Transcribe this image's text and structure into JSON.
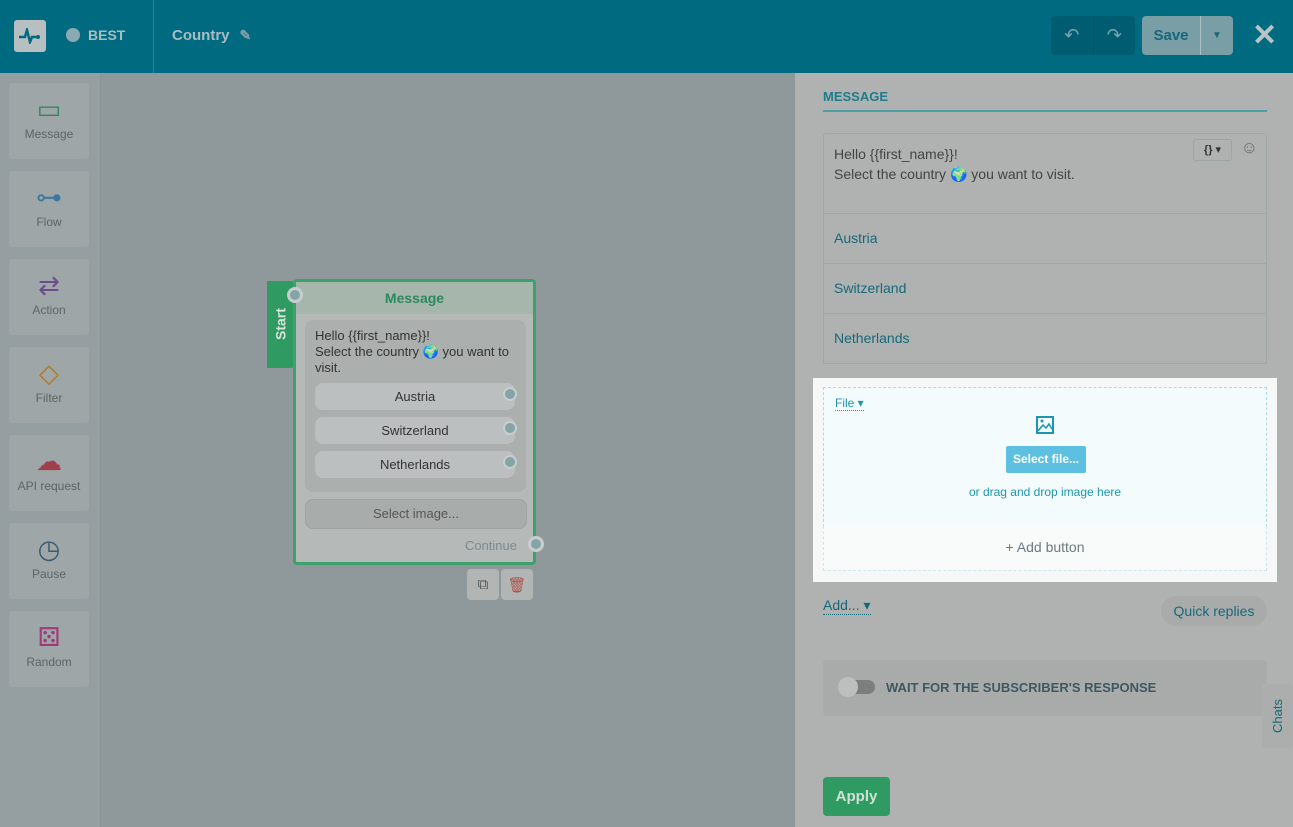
{
  "header": {
    "bot_name": "BEST",
    "flow_name": "Country",
    "save_label": "Save"
  },
  "tools": [
    {
      "label": "Message",
      "icon": "message-icon"
    },
    {
      "label": "Flow",
      "icon": "flow-icon"
    },
    {
      "label": "Action",
      "icon": "action-icon"
    },
    {
      "label": "Filter",
      "icon": "filter-icon"
    },
    {
      "label": "API request",
      "icon": "api-icon"
    },
    {
      "label": "Pause",
      "icon": "timer-icon"
    },
    {
      "label": "Random",
      "icon": "dice-icon"
    }
  ],
  "node": {
    "start_label": "Start",
    "title": "Message",
    "line1": "Hello {{first_name}}!",
    "line2a": "Select the country",
    "line2b": "you want to visit.",
    "buttons": [
      "Austria",
      "Switzerland",
      "Netherlands"
    ],
    "select_image": "Select image...",
    "continue": "Continue"
  },
  "panel": {
    "title": "MESSAGE",
    "text_line1": "Hello {{first_name}}!",
    "text_line2a": "Select the country",
    "text_line2b": "you want to visit.",
    "var_button": "{}",
    "buttons": [
      "Austria",
      "Switzerland",
      "Netherlands"
    ],
    "file_label": "File",
    "select_file": "Select file...",
    "drag_text": "or drag and drop image here",
    "add_button": "+ Add button",
    "add_menu": "Add...",
    "quick_replies": "Quick replies",
    "wait_label": "WAIT FOR THE SUBSCRIBER'S RESPONSE",
    "wait_enabled": false,
    "apply": "Apply"
  },
  "chats": "Chats"
}
